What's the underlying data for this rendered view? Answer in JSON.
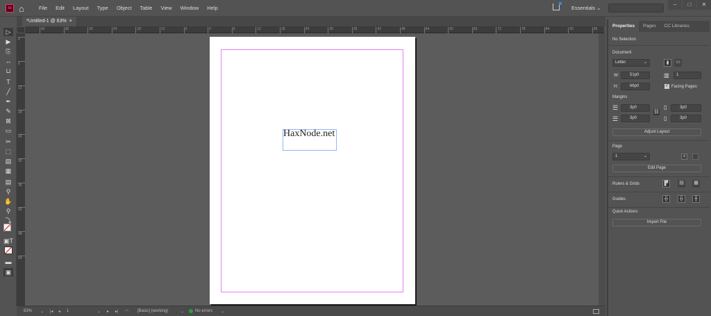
{
  "menubar": {
    "app_icon": "Id",
    "items": [
      "File",
      "Edit",
      "Layout",
      "Type",
      "Object",
      "Table",
      "View",
      "Window",
      "Help"
    ],
    "workspace": "Essentials"
  },
  "document_tab": {
    "title": "*Untitled-1 @ 63%",
    "close": "×"
  },
  "rulers": {
    "horizontal": [
      "42",
      "36",
      "30",
      "24",
      "18",
      "12",
      "6",
      "0",
      "6",
      "12",
      "18",
      "24",
      "30",
      "36",
      "42",
      "48",
      "54",
      "60",
      "66",
      "72",
      "78",
      "84",
      "90",
      "96"
    ],
    "vertical": [
      "0",
      "6",
      "12",
      "18",
      "24",
      "30",
      "36",
      "42",
      "48",
      "54"
    ]
  },
  "page": {
    "text_frame": "HaxNode.net",
    "accent_margin": "#e57ef5",
    "frame_color": "#8fb6f5"
  },
  "status": {
    "zoom": "63%",
    "page": "1",
    "preflight_profile": "[Basic] (working)",
    "errors": "No errors",
    "status_color": "#2e9d3b"
  },
  "panel": {
    "tabs": [
      "Properties",
      "Pages",
      "CC Libraries"
    ],
    "selection": "No Selection",
    "document_label": "Document",
    "page_size": "Letter",
    "width_label": "W:",
    "width": "51p0",
    "height_label": "H:",
    "height": "66p0",
    "pages_count": "1",
    "facing_pages": "Facing Pages",
    "margins_label": "Margins",
    "margin_top": "3p0",
    "margin_bottom": "3p0",
    "margin_inside": "3p0",
    "margin_outside": "3p0",
    "adjust_layout": "Adjust Layout",
    "page_label": "Page",
    "page_value": "1",
    "edit_page": "Edit Page",
    "rulers_grids": "Rulers & Grids",
    "guides": "Guides",
    "quick_actions": "Quick Actions",
    "import_file": "Import File"
  }
}
